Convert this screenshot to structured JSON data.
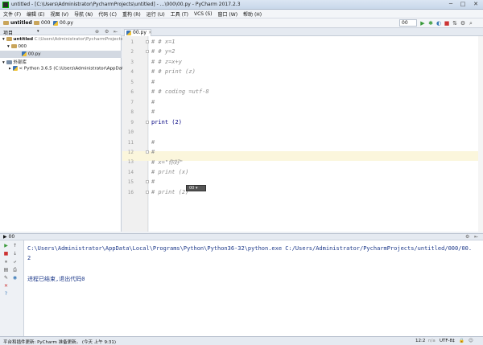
{
  "window": {
    "title": "untitled - [C:\\Users\\Administrator\\PycharmProjects\\untitled] - ...\\000\\00.py - PyCharm 2017.2.3",
    "minimize": "─",
    "maximize": "□",
    "close": "✕"
  },
  "menu": [
    "文件 (F)",
    "编辑 (E)",
    "视图 (V)",
    "导航 (N)",
    "代码 (C)",
    "重构 (R)",
    "运行 (U)",
    "工具 (T)",
    "VCS (S)",
    "窗口 (W)",
    "帮助 (H)"
  ],
  "navbar": {
    "crumbs": [
      "untitled",
      "000",
      "00.py"
    ],
    "run_config": "00"
  },
  "project": {
    "header": "项目",
    "root_name": "untitled",
    "root_path": "C:\\Users\\Administrator\\PycharmProjects\\u",
    "folder": "000",
    "file": "00.py",
    "ext_libs": "外部库",
    "python": "< Python 3.6.5 (C:\\Users\\Administrator\\AppData\\"
  },
  "editor": {
    "tab": "00.py",
    "lines": [
      {
        "n": "1",
        "text": "# # x=1",
        "kind": "comment"
      },
      {
        "n": "2",
        "text": "# # y=2",
        "kind": "comment"
      },
      {
        "n": "3",
        "text": "# # z=x+y",
        "kind": "comment"
      },
      {
        "n": "4",
        "text": "# # print (z)",
        "kind": "comment"
      },
      {
        "n": "5",
        "text": "#",
        "kind": "comment"
      },
      {
        "n": "6",
        "text": "# # coding =utf-8",
        "kind": "comment"
      },
      {
        "n": "7",
        "text": "#",
        "kind": "comment"
      },
      {
        "n": "8",
        "text": "#",
        "kind": "comment"
      },
      {
        "n": "9",
        "text": "print (2)",
        "kind": "plain"
      },
      {
        "n": "10",
        "text": "",
        "kind": "plain"
      },
      {
        "n": "11",
        "text": "#",
        "kind": "comment"
      },
      {
        "n": "12",
        "text": "#",
        "kind": "comment"
      },
      {
        "n": "13",
        "text": "# x=\"你好\"",
        "kind": "comment"
      },
      {
        "n": "14",
        "text": "# print (x)",
        "kind": "comment"
      },
      {
        "n": "15",
        "text": "#",
        "kind": "comment"
      },
      {
        "n": "16",
        "text": "# print (2)",
        "kind": "comment"
      }
    ],
    "tooltip": "00"
  },
  "run": {
    "header": "00",
    "command": "C:\\Users\\Administrator\\AppData\\Local\\Programs\\Python\\Python36-32\\python.exe C:/Users/Administrator/PycharmProjects/untitled/000/00.",
    "result": "2",
    "exit": "进程已结束,退出代码0"
  },
  "status": {
    "message": "平台和插件更新: PyCharm 准备更新。 (今天 上午 9:31)",
    "position": "12:2",
    "line_sep": "n/a",
    "encoding": "UTF-8‡"
  }
}
